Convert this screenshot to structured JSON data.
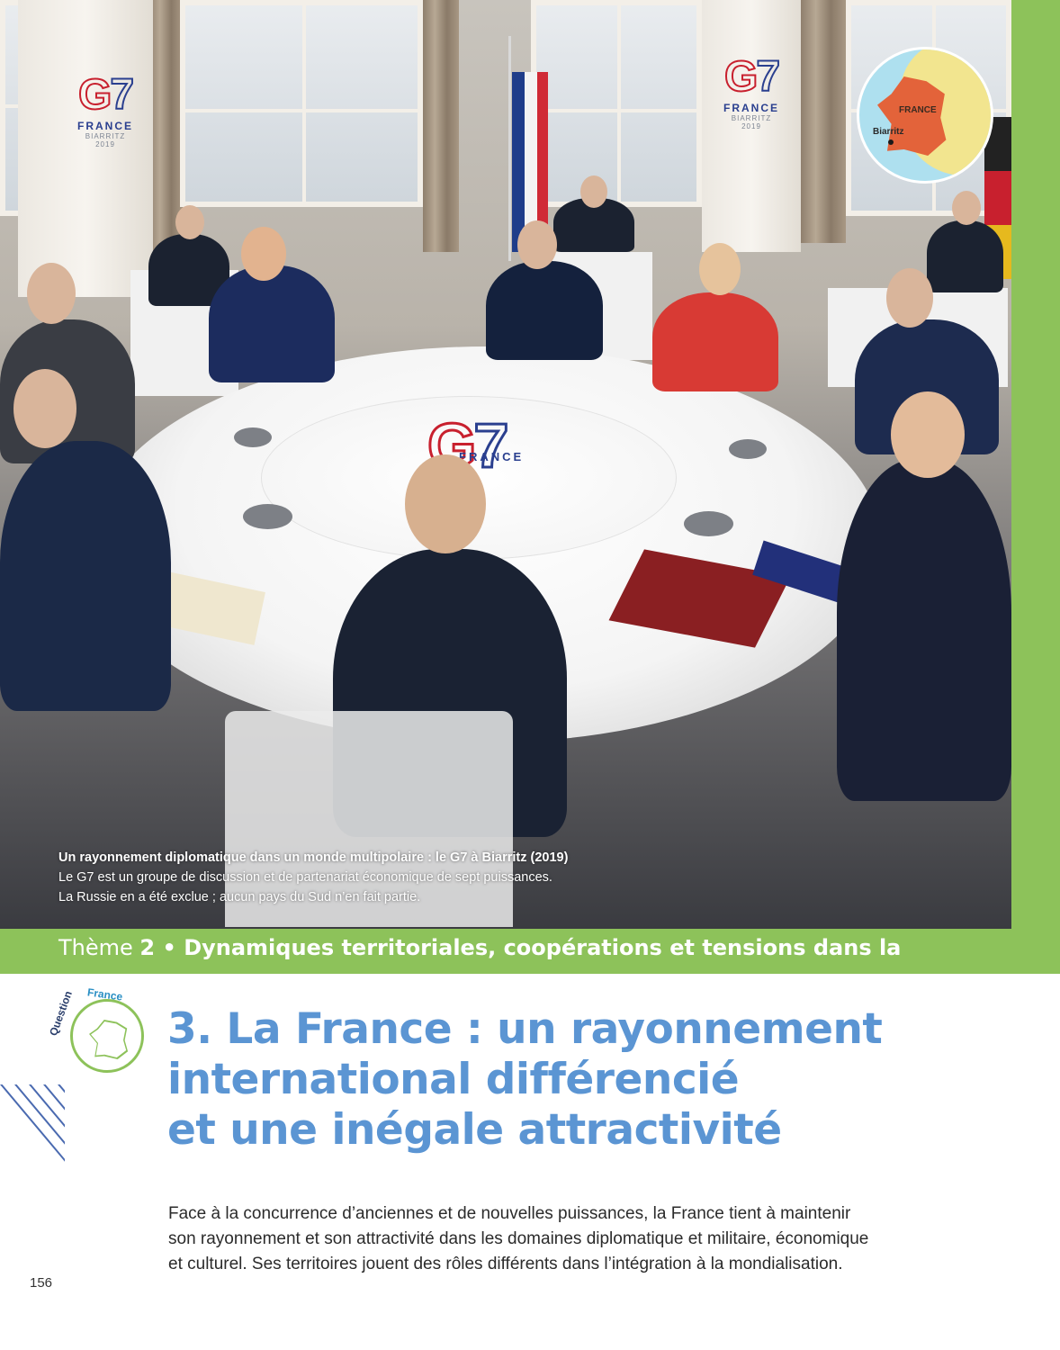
{
  "photo": {
    "logo_text_red": "G",
    "logo_text_blue": "7",
    "logo_country": "FRANCE",
    "logo_city": "BIARRITZ",
    "logo_year": "2019",
    "table_logo_red": "G",
    "table_logo_blue": "7",
    "table_logo_country": "FRANCE"
  },
  "inset_map": {
    "country_label": "FRANCE",
    "city_label": "Biarritz",
    "colors": {
      "sea": "#aee0ef",
      "land": "#f2e58f",
      "france": "#e3633a"
    }
  },
  "caption": {
    "title": "Un rayonnement diplomatique dans un monde multipolaire : le G7 à Biarritz (2019)",
    "line1": "Le G7 est un groupe de discussion et de partenariat économique de sept puissances.",
    "line2": "La Russie en a été exclue ; aucun pays du Sud n’en fait partie."
  },
  "theme": {
    "prefix": "Thème ",
    "number": "2",
    "separator": " • ",
    "title": "Dynamiques territoriales, coopérations et tensions dans la"
  },
  "badge": {
    "word1": "Question",
    "word2": "France"
  },
  "chapter": {
    "line1": "3. La France : un rayonnement",
    "line2": "international différencié",
    "line3": "et une inégale attractivité"
  },
  "intro": {
    "line1": "Face à la concurrence d’anciennes et de nouvelles puissances, la France tient à maintenir",
    "line2": "son rayonnement et son attractivité dans les domaines diplomatique et militaire, économique",
    "line3": "et culturel. Ses territoires jouent des rôles différents dans l’intégration à la mondialisation."
  },
  "page_number": "156",
  "colors": {
    "accent_green": "#8dc25a",
    "title_blue": "#5b95d3",
    "g7_red": "#c8202e",
    "g7_blue": "#2a3f8f"
  }
}
